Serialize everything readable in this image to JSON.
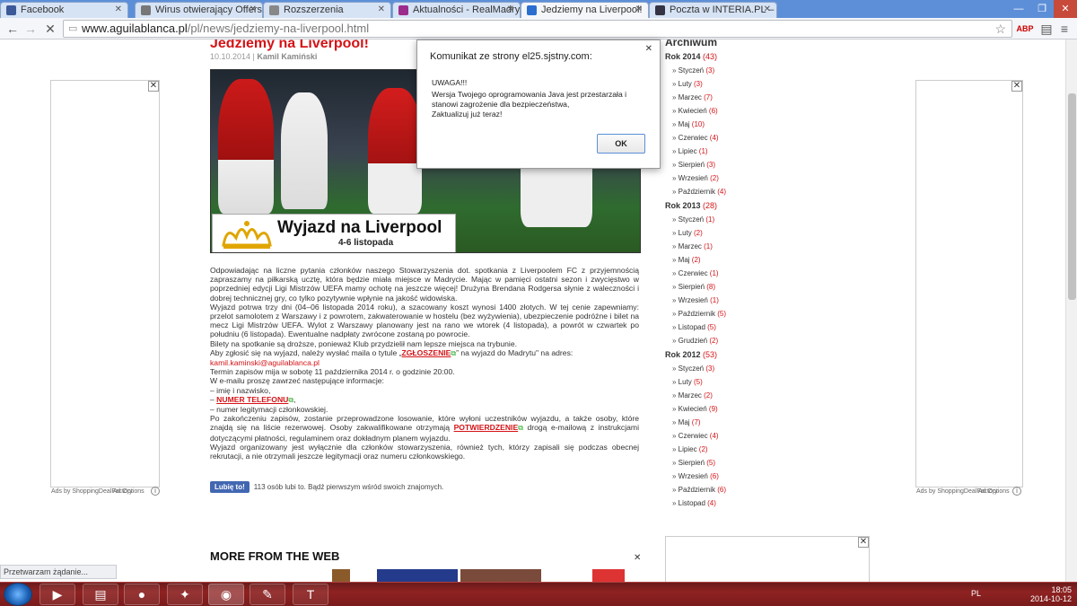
{
  "browser": {
    "tabs": [
      {
        "label": "Facebook",
        "icon": "facebook-icon",
        "color": "#3b5998"
      },
      {
        "label": "Wirus otwierający OffersB…",
        "icon": "forum-icon",
        "color": "#777777"
      },
      {
        "label": "Rozszerzenia",
        "icon": "puzzle-icon",
        "color": "#888888"
      },
      {
        "label": "Aktualności - RealMadryt…",
        "icon": "realmadrid-icon",
        "color": "#9c2c8c"
      },
      {
        "label": "Jedziemy na Liverpool!",
        "icon": "aguila-icon",
        "color": "#2a6fd0",
        "active": true
      },
      {
        "label": "Poczta w INTERIA.PL – log…",
        "icon": "interia-icon",
        "color": "#334"
      }
    ],
    "url_host": "www.aguilablanca.pl",
    "url_path": "/pl/news/jedziemy-na-liverpool.html",
    "status": "Przetwarzam żądanie..."
  },
  "article": {
    "title": "Jedziemy na Liverpool!",
    "date": "10.10.2014",
    "author": "Kamil Kamiński",
    "banner_title": "Wyjazd na Liverpool",
    "banner_dates": "4-6 listopada",
    "p1": "Odpowiadając na liczne pytania członków naszego Stowarzyszenia dot. spotkania z Liverpoolem FC z przyjemnością zapraszamy na piłkarską ucztę, która będzie miała miejsce w Madrycie. Mając w pamięci ostatni sezon i zwycięstwo w poprzedniej edycji Ligi Mistrzów UEFA mamy ochotę na jeszcze więcej! Drużyna Brendana Rodgersa słynie z waleczności i dobrej technicznej gry, co tylko pozytywnie wpłynie na jakość widowiska.",
    "p2": "Wyjazd potrwa trzy dni (04–06 listopada 2014 roku), a szacowany koszt wynosi 1400 złotych. W tej cenie zapewniamy: przelot samolotem z Warszawy i z powrotem, zakwaterowanie w hostelu (bez wyżywienia), ubezpieczenie podróżne i bilet na mecz Ligi Mistrzów UEFA. Wylot z Warszawy planowany jest na rano we wtorek (4 listopada), a powrót w czwartek po południu (6 listopada). Ewentualne nadpłaty zwrócone zostaną po powrocie.",
    "p3": "Bilety na spotkanie są droższe, ponieważ Klub przydzielił nam lepsze miejsca na trybunie.",
    "p4_a": "Aby zgłosić się na wyjazd, należy wysłać maila o tytule „",
    "p4_link": "ZGŁOSZENIE",
    "p4_b": "” na wyjazd do Madrytu\" na adres:",
    "email": "kamil.kaminski@aguilablanca.pl",
    "p5": "Termin zapisów mija w sobotę 11 października 2014 r. o godzinie 20:00.",
    "p6": "W e-mailu proszę zawrzeć następujące informacje:",
    "li1": "– imię i nazwisko,",
    "li2_prefix": "– ",
    "li2_link": "NUMER TELEFONU",
    "li2_suffix": ",",
    "li3": "– numer legitymacji członkowskiej.",
    "p7_a": "Po zakończeniu zapisów, zostanie przeprowadzone losowanie, które wyłoni uczestników wyjazdu, a także osoby, które znajdą się na liście rezerwowej. Osoby zakwalifikowane otrzymają ",
    "p7_link": "POTWIERDZENIE",
    "p7_b": " drogą e-mailową z instrukcjami dotyczącymi płatności, regulaminem oraz dokładnym planem wyjazdu.",
    "p8": "Wyjazd organizowany jest wyłącznie dla członków stowarzyszenia, również tych, którzy zapisali się podczas obecnej rekrutacji, a nie otrzymali jeszcze legitymacji oraz numeru członkowskiego.",
    "like_label": "Lubię to!",
    "like_text": "113 osób lubi to. Bądź pierwszym wśród swoich znajomych.",
    "more_title": "MORE FROM THE WEB"
  },
  "ads": {
    "footer": "Ads by ShoppingDealFactory",
    "options": "Ad Options"
  },
  "sidebar": {
    "title": "Archiwum",
    "years": [
      {
        "year": "Rok 2014",
        "count": "(43)",
        "months": [
          {
            "m": "Styczeń",
            "c": "(3)"
          },
          {
            "m": "Luty",
            "c": "(3)"
          },
          {
            "m": "Marzec",
            "c": "(7)"
          },
          {
            "m": "Kwiecień",
            "c": "(6)"
          },
          {
            "m": "Maj",
            "c": "(10)"
          },
          {
            "m": "Czerwiec",
            "c": "(4)"
          },
          {
            "m": "Lipiec",
            "c": "(1)"
          },
          {
            "m": "Sierpień",
            "c": "(3)"
          },
          {
            "m": "Wrzesień",
            "c": "(2)"
          },
          {
            "m": "Październik",
            "c": "(4)"
          }
        ]
      },
      {
        "year": "Rok 2013",
        "count": "(28)",
        "months": [
          {
            "m": "Styczeń",
            "c": "(1)"
          },
          {
            "m": "Luty",
            "c": "(2)"
          },
          {
            "m": "Marzec",
            "c": "(1)"
          },
          {
            "m": "Maj",
            "c": "(2)"
          },
          {
            "m": "Czerwiec",
            "c": "(1)"
          },
          {
            "m": "Sierpień",
            "c": "(8)"
          },
          {
            "m": "Wrzesień",
            "c": "(1)"
          },
          {
            "m": "Październik",
            "c": "(5)"
          },
          {
            "m": "Listopad",
            "c": "(5)"
          },
          {
            "m": "Grudzień",
            "c": "(2)"
          }
        ]
      },
      {
        "year": "Rok 2012",
        "count": "(53)",
        "months": [
          {
            "m": "Styczeń",
            "c": "(3)"
          },
          {
            "m": "Luty",
            "c": "(5)"
          },
          {
            "m": "Marzec",
            "c": "(2)"
          },
          {
            "m": "Kwiecień",
            "c": "(9)"
          },
          {
            "m": "Maj",
            "c": "(7)"
          },
          {
            "m": "Czerwiec",
            "c": "(4)"
          },
          {
            "m": "Lipiec",
            "c": "(2)"
          },
          {
            "m": "Sierpień",
            "c": "(5)"
          },
          {
            "m": "Wrzesień",
            "c": "(6)"
          },
          {
            "m": "Październik",
            "c": "(6)"
          },
          {
            "m": "Listopad",
            "c": "(4)"
          }
        ]
      }
    ]
  },
  "dialog": {
    "title": "Komunikat ze strony el25.sjstny.com:",
    "line1": "UWAGA!!!",
    "line2": "Wersja Twojego oprogramowania Java jest przestarzała i stanowi zagrożenie dla bezpieczeństwa,",
    "line3": "Zaktualizuj już teraz!",
    "ok": "OK"
  },
  "taskbar": {
    "lang": "PL",
    "time": "18:05",
    "date": "2014-10-12"
  }
}
